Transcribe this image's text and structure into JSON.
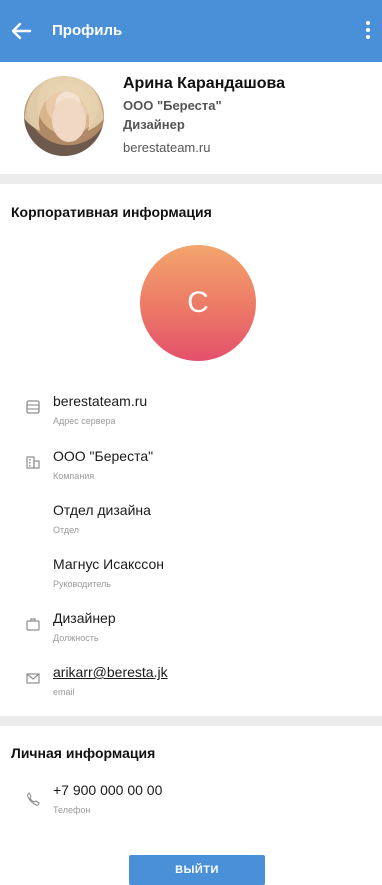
{
  "appbar": {
    "title": "Профиль",
    "back_icon": "arrow-left-icon",
    "menu_icon": "more-vertical-icon",
    "color": "#4a90d9"
  },
  "profile": {
    "name": "Арина Карандашова",
    "company": "ООО \"Береста\"",
    "role": "Дизайнер",
    "server": "berestateam.ru"
  },
  "corporate": {
    "title": "Корпоративная информация",
    "avatar_letter": "C",
    "rows": [
      {
        "icon": "server-icon",
        "value": "berestateam.ru",
        "label": "Адрес сервера"
      },
      {
        "icon": "building-icon",
        "value": "ООО \"Береста\"",
        "label": "Компания"
      },
      {
        "icon": "",
        "value": "Отдел дизайна",
        "label": "Отдел"
      },
      {
        "icon": "",
        "value": "Магнус Исакссон",
        "label": "Руководитель"
      },
      {
        "icon": "briefcase-icon",
        "value": "Дизайнер",
        "label": "Должность"
      },
      {
        "icon": "mail-icon",
        "value": "arikarr@beresta.jk",
        "label": "email"
      }
    ]
  },
  "personal": {
    "title": "Личная информация",
    "rows": [
      {
        "icon": "phone-icon",
        "value": "+7 900 000 00 00",
        "label": "Телефон"
      }
    ]
  },
  "logout": {
    "label": "ВЫЙТИ"
  }
}
